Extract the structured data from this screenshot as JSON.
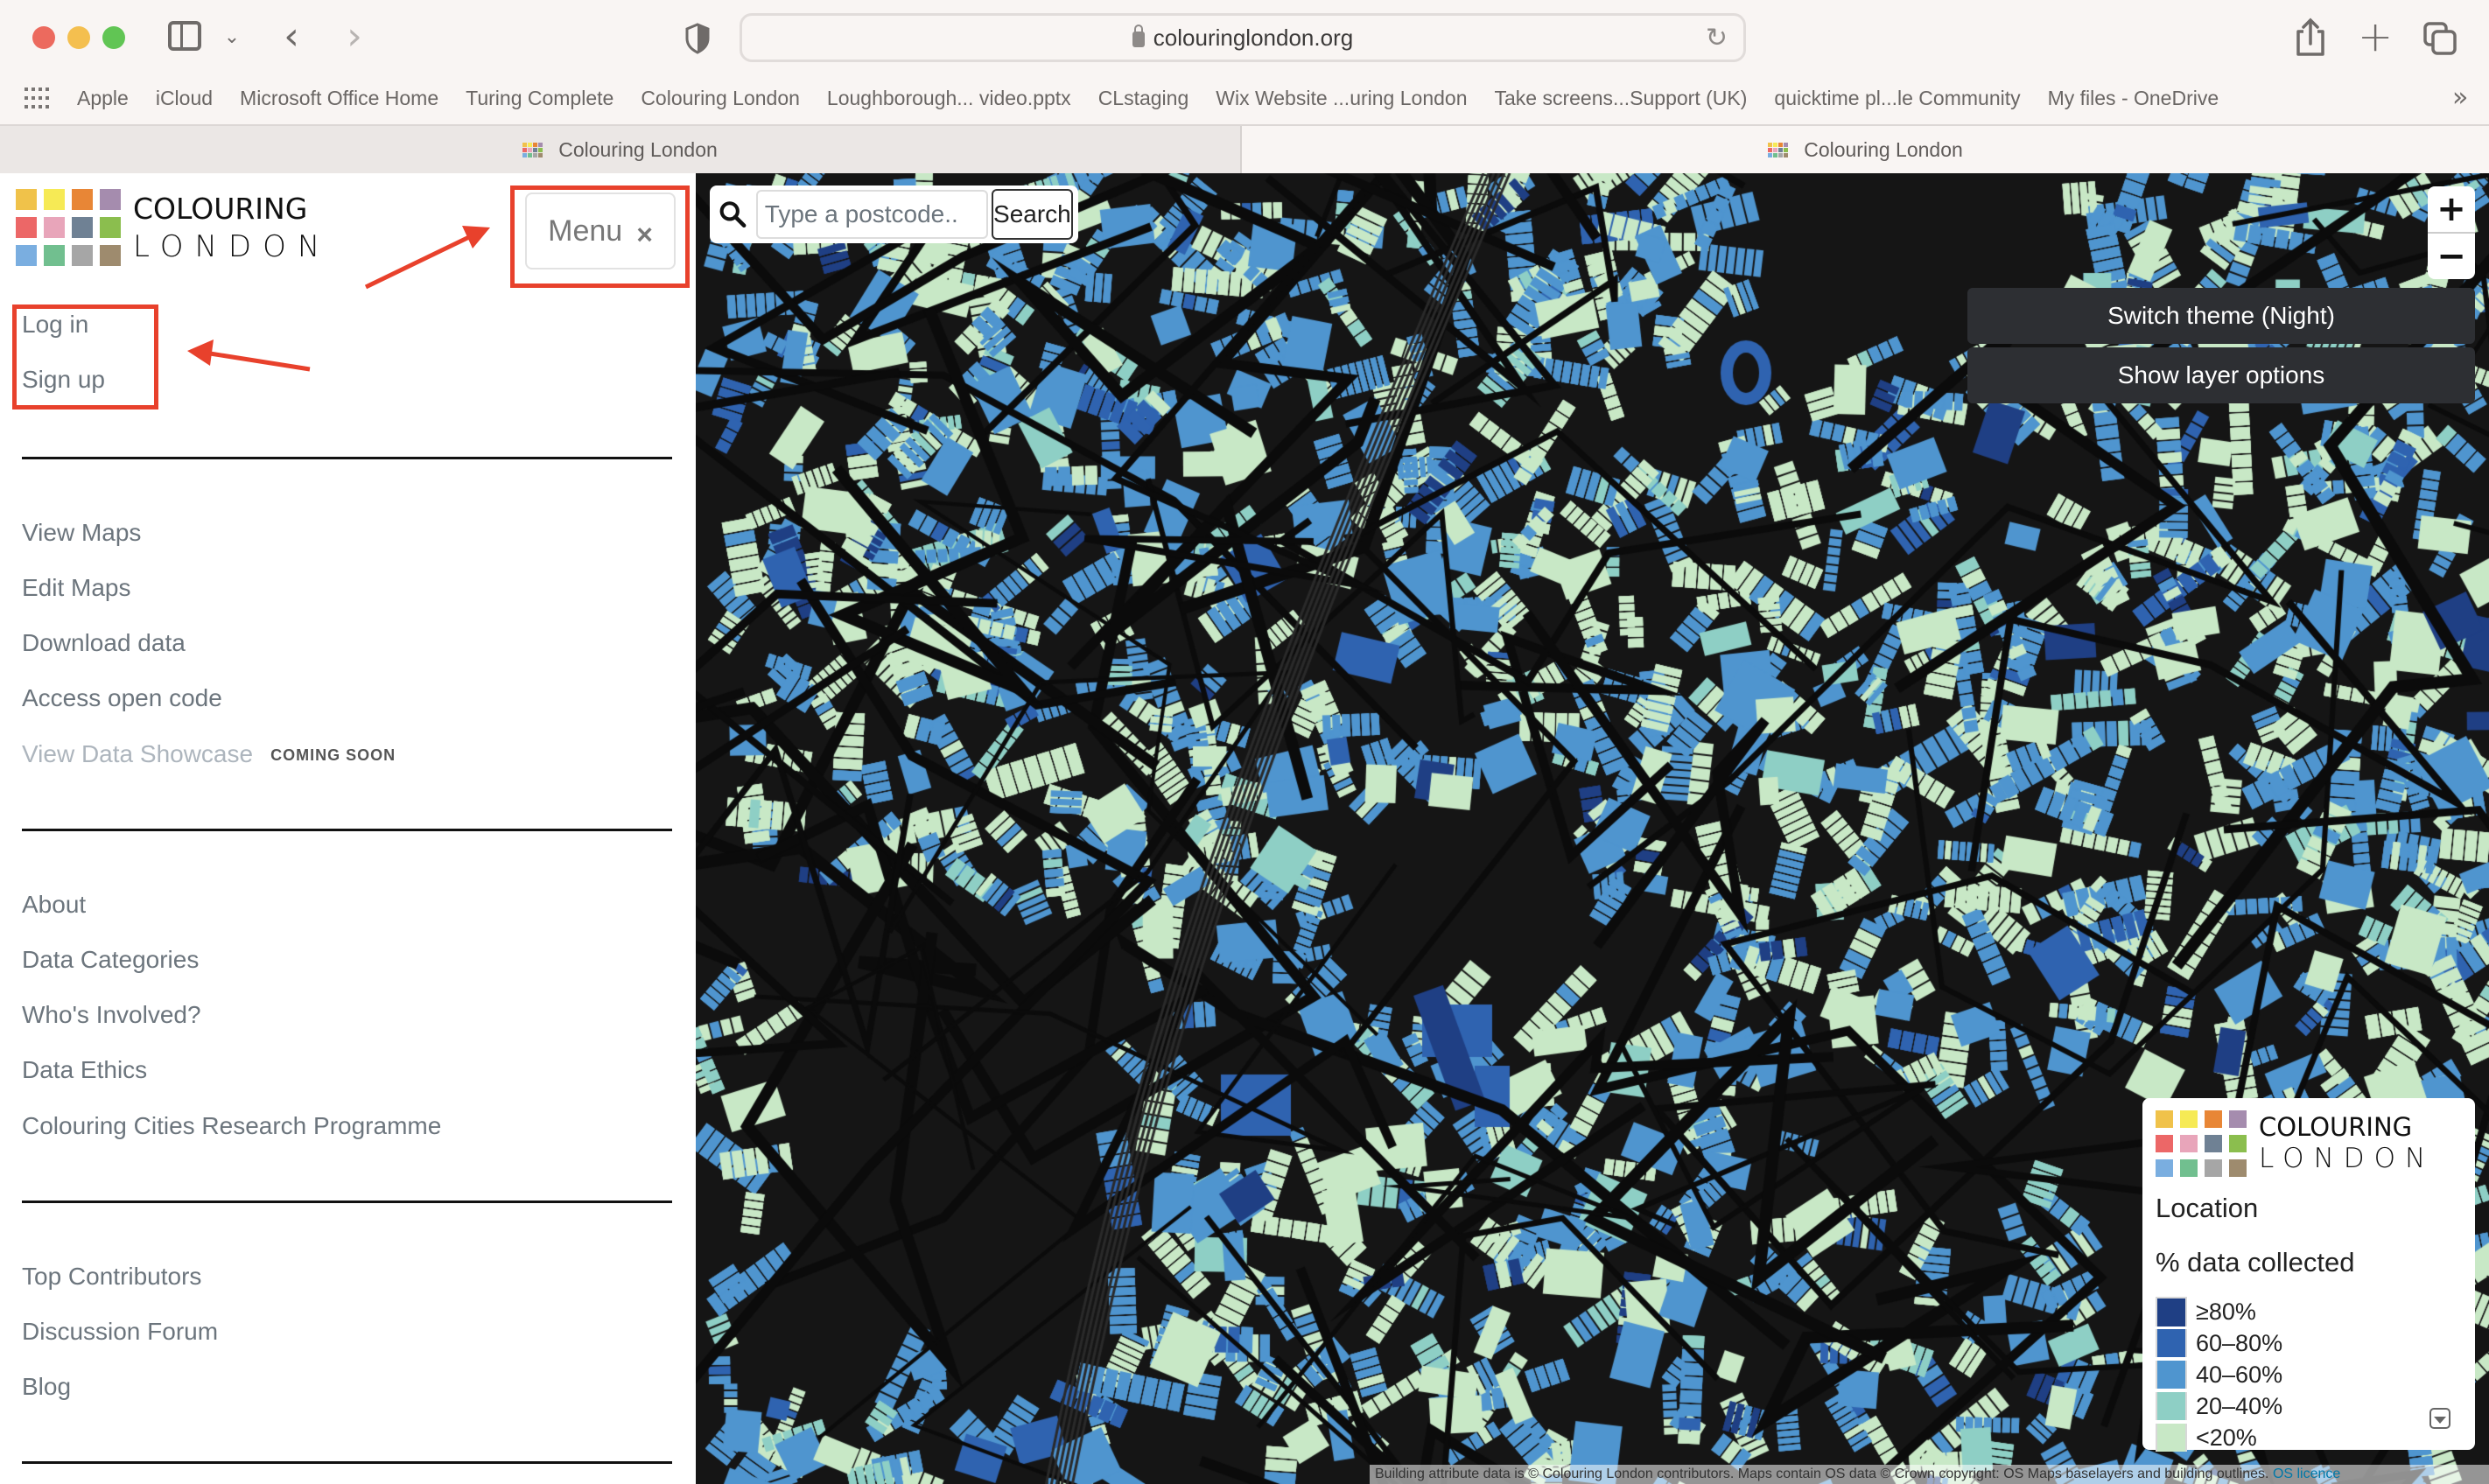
{
  "browser": {
    "url": "colouringlondon.org",
    "bookmarks": [
      "Apple",
      "iCloud",
      "Microsoft Office Home",
      "Turing Complete",
      "Colouring London",
      "Loughborough... video.pptx",
      "CLstaging",
      "Wix Website ...uring London",
      "Take screens...Support (UK)",
      "quicktime pl...le Community",
      "My files - OneDrive"
    ],
    "tabs": [
      {
        "title": "Colouring London",
        "active": false
      },
      {
        "title": "Colouring London",
        "active": true
      }
    ],
    "more_bookmarks_glyph": "»"
  },
  "logo": {
    "line1": "COLOURING",
    "line2": "LONDON",
    "colors": [
      "#f0c24a",
      "#f6ea55",
      "#e88636",
      "#a58cae",
      "#ec6767",
      "#e8a5ba",
      "#6f8194",
      "#8bbe4e",
      "#7aaee0",
      "#71bf8f",
      "#a6a6a6",
      "#9e8b6e"
    ]
  },
  "sidebar": {
    "menu_button": {
      "label": "Menu",
      "close_glyph": "×"
    },
    "auth": {
      "login": "Log in",
      "signup": "Sign up"
    },
    "sections": [
      {
        "items": [
          {
            "label": "View Maps"
          },
          {
            "label": "Edit Maps"
          },
          {
            "label": "Download data"
          },
          {
            "label": "Access open code"
          },
          {
            "label": "View Data Showcase",
            "disabled": true,
            "badge": "COMING SOON"
          }
        ]
      },
      {
        "items": [
          {
            "label": "About"
          },
          {
            "label": "Data Categories"
          },
          {
            "label": "Who's Involved?"
          },
          {
            "label": "Data Ethics"
          },
          {
            "label": "Colouring Cities Research Programme"
          }
        ]
      },
      {
        "items": [
          {
            "label": "Top Contributors"
          },
          {
            "label": "Discussion Forum"
          },
          {
            "label": "Blog"
          }
        ]
      }
    ]
  },
  "map": {
    "search": {
      "placeholder": "Type a postcode..",
      "value": "",
      "button": "Search"
    },
    "zoom_in": "+",
    "zoom_out": "−",
    "theme_button": "Switch theme (Night)",
    "layer_button": "Show layer options",
    "legend": {
      "title": "Location",
      "subtitle": "% data collected",
      "items": [
        {
          "label": "≥80%",
          "color": "#1f3f84"
        },
        {
          "label": "60–80%",
          "color": "#2f63b0"
        },
        {
          "label": "40–60%",
          "color": "#4f95cf"
        },
        {
          "label": "20–40%",
          "color": "#8ecfc5"
        },
        {
          "label": "<20%",
          "color": "#c8e8c6"
        }
      ]
    },
    "attribution": {
      "text": "Building attribute data is © Colouring London contributors. Maps contain OS data © Crown copyright: OS Maps baselayers and building outlines.",
      "link": "OS licence"
    }
  },
  "annotations": {
    "color": "#e8412c"
  }
}
